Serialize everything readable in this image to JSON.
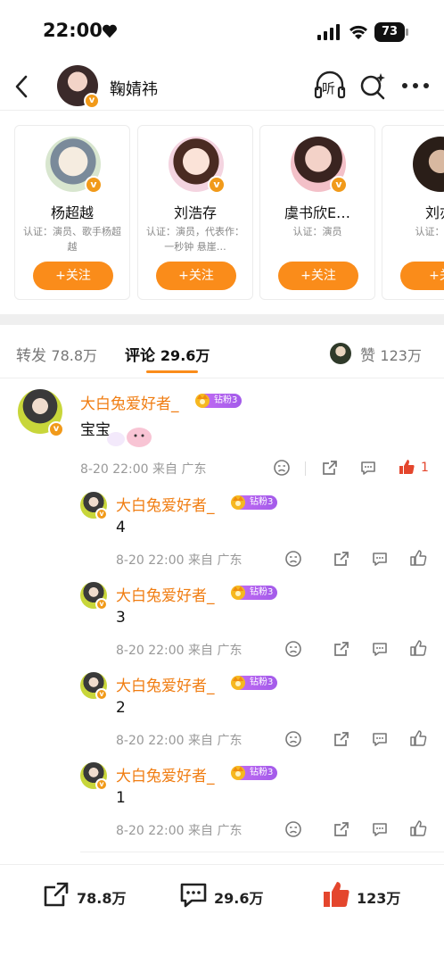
{
  "status_bar": {
    "time": "22:00",
    "battery": "73"
  },
  "header": {
    "title": "鞠婧祎",
    "listen_label": "听"
  },
  "cards": [
    {
      "name": "杨超越",
      "cert": "认证：演员、歌手杨超越",
      "follow_label": "+关注"
    },
    {
      "name": "刘浩存",
      "cert": "认证：演员，代表作：一秒钟 悬崖…",
      "follow_label": "+关注"
    },
    {
      "name": "虞书欣E…",
      "cert": "认证：演员",
      "follow_label": "+关注"
    },
    {
      "name": "刘亦",
      "cert": "认证：演员",
      "follow_label": "+关"
    }
  ],
  "tabs": {
    "repost": {
      "label": "转发",
      "count": "78.8万"
    },
    "comment": {
      "label": "评论",
      "count": "29.6万"
    },
    "like": {
      "label": "赞",
      "count": "123万"
    }
  },
  "comments": [
    {
      "user": "大白兔爱好者_",
      "badge": "钻粉3",
      "text": "宝宝",
      "time": "8-20 22:00",
      "source": "来自 广东",
      "likes": "1"
    },
    {
      "user": "大白兔爱好者_",
      "badge": "钻粉3",
      "text": "4",
      "time": "8-20 22:00",
      "source": "来自 广东"
    },
    {
      "user": "大白兔爱好者_",
      "badge": "钻粉3",
      "text": "3",
      "time": "8-20 22:00",
      "source": "来自 广东"
    },
    {
      "user": "大白兔爱好者_",
      "badge": "钻粉3",
      "text": "2",
      "time": "8-20 22:00",
      "source": "来自 广东"
    },
    {
      "user": "大白兔爱好者_",
      "badge": "钻粉3",
      "text": "1",
      "time": "8-20 22:00",
      "source": "来自 广东"
    }
  ],
  "bottom_bar": {
    "repost": "78.8万",
    "comment": "29.6万",
    "like": "123万"
  },
  "colors": {
    "accent": "#fa8c1a",
    "username": "#f07d12",
    "like_red": "#e4462d",
    "fan_badge": "#b063ee"
  }
}
